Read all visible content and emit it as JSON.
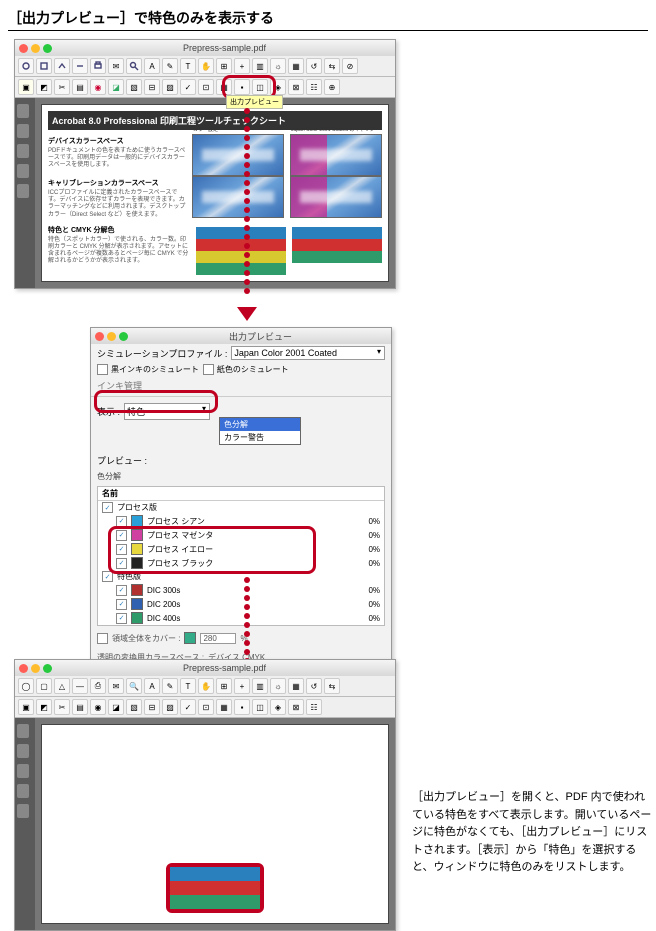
{
  "page_title": "［出力プレビュー］で特色のみを表示する",
  "acrobat_window": {
    "filename": "Prepress-sample.pdf",
    "doc_heading": "Acrobat 8.0 Professional 印刷工程ツールチェックシート",
    "section1_h": "デバイスカラースペース",
    "section1_p": "PDFドキュメントの色を表すために使うカラースペースです。印刷用データは一般的にデバイスカラースペースを使用します。",
    "section2_h": "キャリブレーションカラースペース",
    "section2_p": "ICCプロファイルに定義されたカラースペースです。デバイスに依存せずカラーを表現できます。カラーマッチングなどに利用されます。デスクトップカラー（Direct Select など）を使えます。",
    "section3_h": "特色と CMYK 分解色",
    "section3_p": "特色（スポットカラー）で使される、カラー数。印刷カラーと CMYK 分解が表示されます。アセットに含まれるページが複数あるとページ毎に CMYK で分解されるかどうかが表示されます。",
    "sky_label_left": "カラー設定",
    "sky_label_right": "Japan Color 2001 Coated のキャリブ",
    "output_tooltip": "出力プレビュー"
  },
  "dialog": {
    "title": "出力プレビュー",
    "profile_label": "シミュレーションプロファイル :",
    "profile_value": "Japan Color 2001 Coated",
    "sim_ink_black": "黒インキのシミュレート",
    "sim_paper": "紙色のシミュレート",
    "ink_admin": "インキ管理",
    "show_label": "表示 :",
    "show_value": "特色",
    "dropdown_opts": [
      "色分解",
      "カラー警告"
    ],
    "preview_label": "プレビュー :",
    "sep_section": "色分解",
    "head_name": "名前",
    "rows_process_h": "プロセス版",
    "rows": [
      {
        "name": "プロセス シアン",
        "swatch": "#2aa0d8",
        "pct": "0%"
      },
      {
        "name": "プロセス マゼンタ",
        "swatch": "#d040a0",
        "pct": "0%"
      },
      {
        "name": "プロセス イエロー",
        "swatch": "#e8d840",
        "pct": "0%"
      },
      {
        "name": "プロセス ブラック",
        "swatch": "#222222",
        "pct": "0%"
      }
    ],
    "spot_header": "特色版",
    "spot_rows": [
      {
        "name": "DIC 300s",
        "swatch": "#b03030",
        "pct": "0%"
      },
      {
        "name": "DIC 200s",
        "swatch": "#3060b0",
        "pct": "0%"
      },
      {
        "name": "DIC 400s",
        "swatch": "#2f9a6a",
        "pct": "0%"
      }
    ],
    "coverage_label": "領域全体をカバー :",
    "coverage_value": "280",
    "coverage_pct": "%",
    "transform_label": "透明の変換用カラースペース :",
    "transform_value": "デバイス CMYK"
  },
  "caption_text": "［出力プレビュー］を開くと、PDF 内で使われている特色をすべて表示します。開いているページに特色がなくても、［出力プレビュー］にリストされます。［表示］から「特色」を選択すると、ウィンドウに特色のみをリストします。"
}
